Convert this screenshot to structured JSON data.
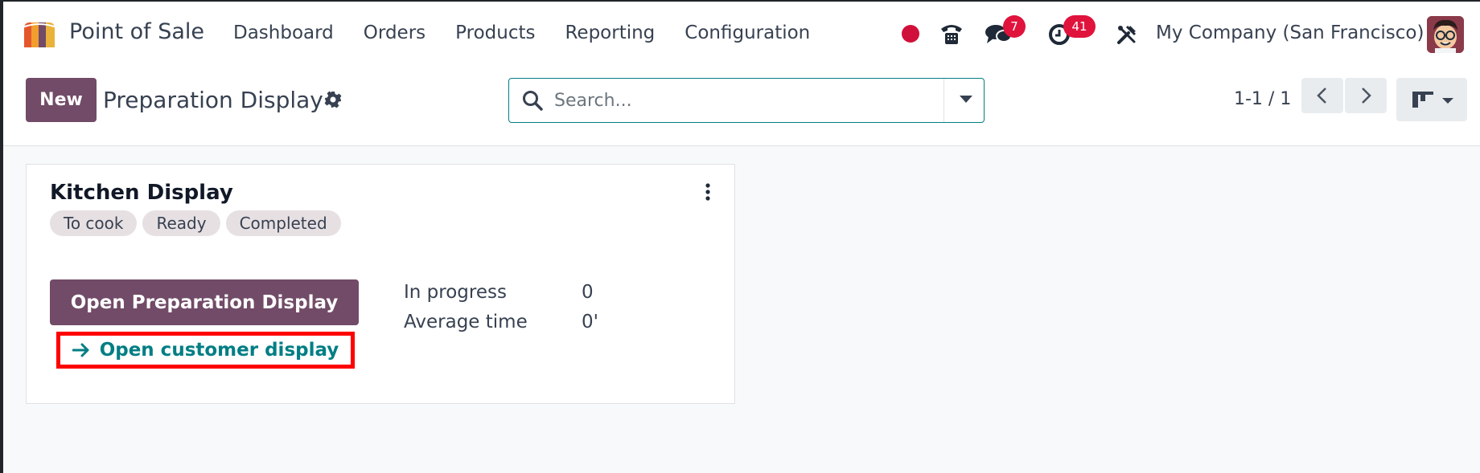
{
  "navbar": {
    "app_name": "Point of Sale",
    "menu": [
      "Dashboard",
      "Orders",
      "Products",
      "Reporting",
      "Configuration"
    ],
    "messages_badge": "7",
    "activities_badge": "41",
    "company": "My Company (San Francisco)",
    "icons": [
      "record-dot-icon",
      "phone-icon",
      "chat-icon",
      "clock-icon",
      "tools-icon",
      "avatar"
    ]
  },
  "control": {
    "new_label": "New",
    "title": "Preparation Display",
    "search_placeholder": "Search...",
    "pager": "1-1 / 1"
  },
  "card": {
    "title": "Kitchen Display",
    "tags": [
      "To cook",
      "Ready",
      "Completed"
    ],
    "open_label": "Open Preparation Display",
    "customer_label": "Open customer display",
    "stats": [
      {
        "label": "In progress",
        "value": "0"
      },
      {
        "label": "Average time",
        "value": "0'"
      }
    ]
  },
  "colors": {
    "primary": "#714b67",
    "accent": "#017e84",
    "badge": "#e0133d",
    "highlight": "#ff0000"
  }
}
